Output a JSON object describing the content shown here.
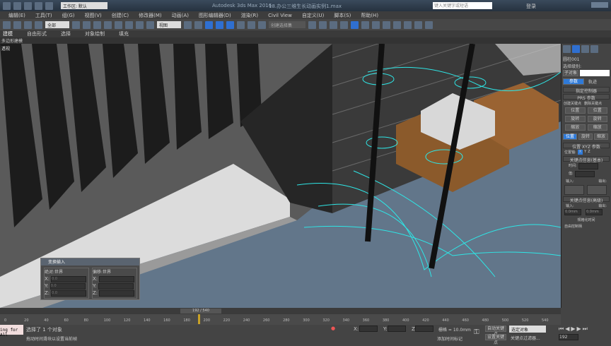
{
  "title": {
    "workspace": "工作区: 默认",
    "app": "Autodesk 3ds Max 2016",
    "file": "18.办公三维生长动画实例1.max",
    "search_placeholder": "键入关键字或短语",
    "login": "登录"
  },
  "menu": [
    "编辑(E)",
    "工具(T)",
    "组(G)",
    "视图(V)",
    "创建(C)",
    "修改器(M)",
    "动画(A)",
    "图形编辑器(D)",
    "渲染(R)",
    "Civil View",
    "自定义(U)",
    "脚本(S)",
    "帮助(H)"
  ],
  "toolbar": {
    "filter": "全部",
    "refcoord": "视图",
    "selset": "创建选择集"
  },
  "ribbon": [
    "建模",
    "自由形式",
    "选择",
    "对象绘制",
    "填充"
  ],
  "subribbon": "多边形建模",
  "viewport_label": "透视",
  "panel": {
    "object": "圆柱001",
    "sel_level": "选择级别:",
    "subobj": "子对象",
    "tab_params": "参数",
    "tab_track": "轨迹",
    "assign": "指定控制器",
    "prs": "PRS 参数",
    "create_key": "创建关键点",
    "delete_key": "删除关键点",
    "pos": "位置",
    "rot": "旋转",
    "scale": "缩放",
    "xyz": "位置 XYZ 参数",
    "axis": "位置轴:",
    "x": "X",
    "y": "Y",
    "z": "Z",
    "keyinfo_basic": "关键点信息(基本)",
    "time": "时间:",
    "value": "值:",
    "in": "输入:",
    "out": "输出:",
    "keyinfo_adv": "关键点信息(高级)",
    "in_val": "0.0mm",
    "out_val": "0.0mm",
    "normalize": "规格化时间",
    "free_handle": "自由控制柄"
  },
  "dialog": {
    "title": "变换输入",
    "abs": "绝对:世界",
    "offset": "偏移:世界",
    "x": "X:",
    "y": "Y:",
    "z": "Z:",
    "absval": "0.0"
  },
  "timeline": {
    "frame": "192 / 540",
    "ticks": [
      "0",
      "20",
      "40",
      "60",
      "80",
      "100",
      "120",
      "140",
      "160",
      "180",
      "200",
      "220",
      "240",
      "260",
      "280",
      "300",
      "320",
      "340",
      "360",
      "380",
      "400",
      "420",
      "440",
      "460",
      "480",
      "500",
      "520",
      "540"
    ],
    "current": 192,
    "total": 540
  },
  "status": {
    "script": "ing for All",
    "line1": "选择了 1 个对象",
    "line2": "拖动时间滑块以设置当前帧",
    "x": "X:",
    "y": "Y:",
    "z": "Z:",
    "grid": "栅格 = 10.0mm",
    "add_tag": "添加时间标记",
    "autokey": "自动关键点",
    "setkey": "设置关键点",
    "selected": "选定对象",
    "filter": "关键点过滤器...",
    "frame": "192"
  }
}
